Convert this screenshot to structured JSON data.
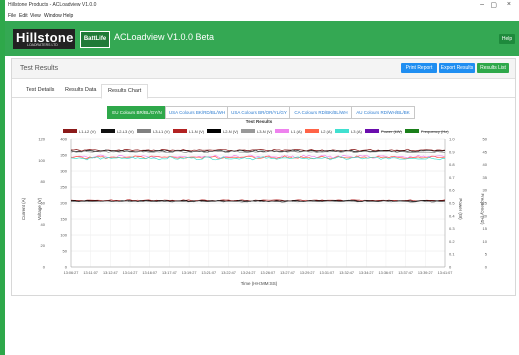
{
  "window": {
    "title": "Hillstone Products - ACLoadview V1.0.0",
    "controls": [
      "–",
      "▢",
      "×"
    ]
  },
  "menu": [
    "File",
    "Edit",
    "View",
    "Window",
    "Help"
  ],
  "header": {
    "logo_text": "Hillstone",
    "logo_subtext": "LOADRATERS LTD",
    "badge": "BattLife",
    "app_title": "ACLoadview V1.0.0 Beta",
    "help": "Help"
  },
  "card": {
    "title": "Test Results",
    "buttons": {
      "print": "Print Report",
      "export": "Export Results",
      "list": "Results List"
    }
  },
  "tabs": [
    "Test Details",
    "Results Data",
    "Results Chart"
  ],
  "active_tab": "Results Chart",
  "color_tabs": [
    "EU Colours BR/BL/GY/N",
    "USA Colours BK/RD/BL/WH",
    "USA Colours BR/OR/YL/GY",
    "CA Colours RD/BK/BL/WH",
    "AU Colours RD/WH/BL/BK"
  ],
  "colors": {
    "brand_green": "#34a853",
    "button_blue": "#1f8ef1",
    "button_green": "#2ea84a",
    "active_tab_green": "#2ea84a",
    "link_blue": "#2e7dd1"
  },
  "chart_data": {
    "type": "line",
    "title": "Test Results",
    "xlabel": "Time (HH:MM:SS)",
    "ylabel_left": "Current (A)",
    "ylabel_left2": "Voltage (V)",
    "ylabel_right": "Power (W)",
    "ylabel_right2": "Frequency (Hz)",
    "x_ticks": [
      "13:06:27",
      "13:11:07",
      "13:12:47",
      "13:14:27",
      "13:16:07",
      "13:17:47",
      "13:19:27",
      "13:21:07",
      "13:22:47",
      "13:24:27",
      "13:26:07",
      "13:27:47",
      "13:29:27",
      "13:31:07",
      "13:32:47",
      "13:34:27",
      "13:36:07",
      "13:37:47",
      "13:39:27",
      "13:41:07"
    ],
    "y_left_current": [
      "0",
      "20",
      "40",
      "60",
      "80",
      "100",
      "120"
    ],
    "y_left_voltage": [
      "0",
      "50",
      "100",
      "150",
      "200",
      "250",
      "300",
      "350",
      "400"
    ],
    "y_right_power": [
      "0",
      "0.1",
      "0.2",
      "0.3",
      "0.4",
      "0.5",
      "0.6",
      "0.7",
      "0.8",
      "0.9",
      "1.0"
    ],
    "y_right_freq": [
      "0",
      "5",
      "10",
      "15",
      "20",
      "25",
      "30",
      "35",
      "40",
      "45",
      "50"
    ],
    "ylim_current": [
      0,
      120
    ],
    "legend": [
      {
        "name": "L1-L2 (V)",
        "color": "#8b1a1a",
        "struck": false
      },
      {
        "name": "L2-L3 (V)",
        "color": "#111111",
        "struck": false
      },
      {
        "name": "L3-L1 (V)",
        "color": "#808080",
        "struck": false
      },
      {
        "name": "L1-N (V)",
        "color": "#b22222",
        "struck": false
      },
      {
        "name": "L2-N (V)",
        "color": "#000000",
        "struck": false
      },
      {
        "name": "L3-N (V)",
        "color": "#999999",
        "struck": false
      },
      {
        "name": "L1 (A)",
        "color": "#ee82ee",
        "struck": false
      },
      {
        "name": "L2 (A)",
        "color": "#ff6347",
        "struck": false
      },
      {
        "name": "L3 (A)",
        "color": "#40e0d0",
        "struck": false
      },
      {
        "name": "Power (kW)",
        "color": "#6a0dad",
        "struck": true
      },
      {
        "name": "Frequency (Hz)",
        "color": "#1a7f1a",
        "struck": true
      }
    ],
    "series": [
      {
        "name": "L1-L2 (V)",
        "level": 109.5,
        "color": "#8b1a1a",
        "amp": 0.6,
        "seed": 1
      },
      {
        "name": "L2-L3 (V)",
        "level": 108.8,
        "color": "#111111",
        "amp": 0.6,
        "seed": 2
      },
      {
        "name": "L3-L1 (V)",
        "level": 108.0,
        "color": "#808080",
        "amp": 0.6,
        "seed": 3
      },
      {
        "name": "L1 (A)",
        "level": 103.5,
        "color": "#ee82ee",
        "amp": 1.0,
        "seed": 4
      },
      {
        "name": "L2 (A)",
        "level": 102.8,
        "color": "#ff6347",
        "amp": 1.0,
        "seed": 5
      },
      {
        "name": "L3 (A)",
        "level": 102.0,
        "color": "#40e0d0",
        "amp": 1.0,
        "seed": 6
      },
      {
        "name": "L1-N (V)",
        "level": 62.5,
        "color": "#b22222",
        "amp": 0.4,
        "seed": 7
      },
      {
        "name": "L2-N (V)",
        "level": 62.0,
        "color": "#000000",
        "amp": 0.4,
        "seed": 8
      },
      {
        "name": "L3-N (V)",
        "level": 61.5,
        "color": "#555555",
        "amp": 0.4,
        "seed": 9
      }
    ]
  }
}
